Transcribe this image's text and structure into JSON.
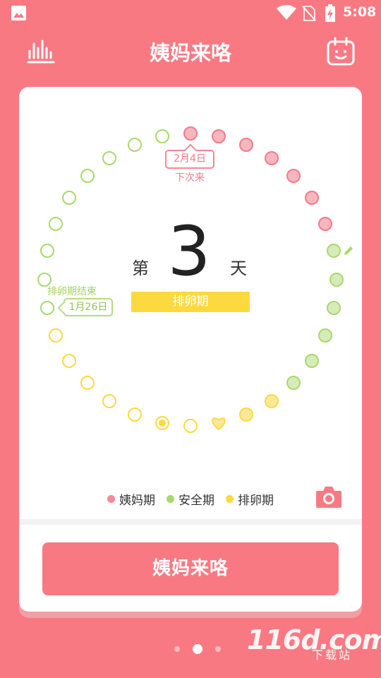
{
  "status_bar": {
    "time": "5:08",
    "icons": [
      "gallery-icon",
      "wifi-icon",
      "no-sim-icon",
      "battery-charging-icon"
    ]
  },
  "header": {
    "title": "姨妈来咯",
    "left_icon": "bar-chart-icon",
    "right_icon": "calendar-face-icon"
  },
  "cycle": {
    "day_prefix": "第",
    "day_number": "3",
    "day_suffix": "天",
    "phase": "排卵期",
    "next_period_date": "2月4日",
    "next_period_label": "下次来",
    "ovulation_end_label": "排卵期结束",
    "ovulation_end_date": "1月26日"
  },
  "legend": [
    {
      "label": "姨妈期",
      "color": "#f58995"
    },
    {
      "label": "安全期",
      "color": "#a9d86e"
    },
    {
      "label": "排卵期",
      "color": "#fcd93f"
    }
  ],
  "colors": {
    "accent": "#f97983",
    "period": "#f58995",
    "safe": "#a9d86e",
    "ovulation": "#fcd93f"
  },
  "main_button": "姨妈来咯",
  "pager": {
    "count": 3,
    "active": 1
  },
  "watermark": {
    "brand": "116d.com",
    "sub": "下载站"
  }
}
